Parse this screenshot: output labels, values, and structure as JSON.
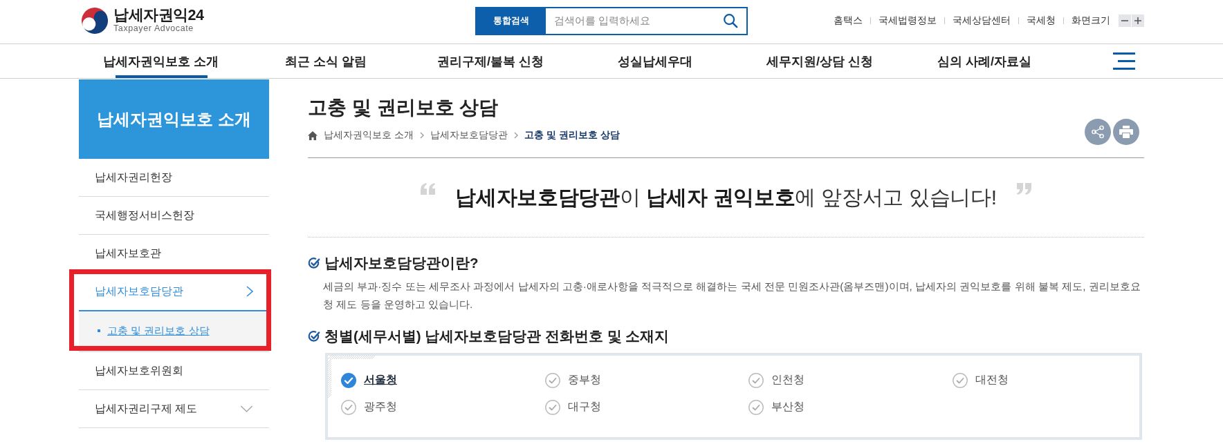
{
  "header": {
    "logo": {
      "title": "납세자권익24",
      "subtitle": "Taxpayer Advocate"
    },
    "search": {
      "button": "통합검색",
      "placeholder": "검색어를 입력하세요"
    },
    "utility_links": [
      "홈택스",
      "국세법령정보",
      "국세상담센터",
      "국세청"
    ],
    "font_size_control": {
      "label": "화면크기"
    }
  },
  "nav": {
    "items": [
      {
        "label": "납세자권익보호 소개",
        "selected": true
      },
      {
        "label": "최근 소식 알림",
        "selected": false
      },
      {
        "label": "권리구제/불복 신청",
        "selected": false
      },
      {
        "label": "성실납세우대",
        "selected": false
      },
      {
        "label": "세무지원/상담 신청",
        "selected": false
      },
      {
        "label": "심의 사례/자료실",
        "selected": false
      }
    ]
  },
  "sidebar": {
    "title": "납세자권익보호 소개",
    "items": [
      {
        "kind": "page",
        "label": "납세자권리헌장",
        "selected": false,
        "highlighted": false
      },
      {
        "kind": "page",
        "label": "국세행정서비스헌장",
        "selected": false,
        "highlighted": false
      },
      {
        "kind": "page",
        "label": "납세자보호관",
        "selected": false,
        "highlighted": false
      },
      {
        "kind": "group",
        "label": "납세자보호담당관",
        "selected": true,
        "expanded": true,
        "highlighted": true,
        "children": [
          {
            "label": "고충 및 권리보호 상담",
            "selected": true
          }
        ]
      },
      {
        "kind": "page",
        "label": "납세자보호위원회",
        "selected": false,
        "highlighted": false
      },
      {
        "kind": "group",
        "label": "납세자권리구제 제도",
        "selected": false,
        "expanded": false,
        "highlighted": false
      }
    ]
  },
  "page": {
    "title": "고충 및 권리보호 상담",
    "breadcrumb": [
      "납세자권익보호 소개",
      "납세자보호담당관",
      "고충 및 권리보호 상담"
    ],
    "banner": "**납세자보호담당관**이 **납세자 권익보호**에 앞장서고 있습니다!",
    "sections": [
      {
        "heading": "납세자보호담당관이란?",
        "text": "세금의 부과·징수 또는 세무조사 과정에서 납세자의 고충·애로사항을 적극적으로 해결하는 국세 전문 민원조사관(옴부즈맨)이며, 납세자의 권익보호를 위해 불복 제도, 권리보호요청 제도 등을 운영하고 있습니다."
      },
      {
        "heading": "청별(세무서별) 납세자보호담당관 전화번호 및 소재지",
        "offices": [
          {
            "label": "서울청",
            "selected": true
          },
          {
            "label": "중부청",
            "selected": false
          },
          {
            "label": "인천청",
            "selected": false
          },
          {
            "label": "대전청",
            "selected": false
          },
          {
            "label": "광주청",
            "selected": false
          },
          {
            "label": "대구청",
            "selected": false
          },
          {
            "label": "부산청",
            "selected": false
          }
        ]
      }
    ]
  }
}
